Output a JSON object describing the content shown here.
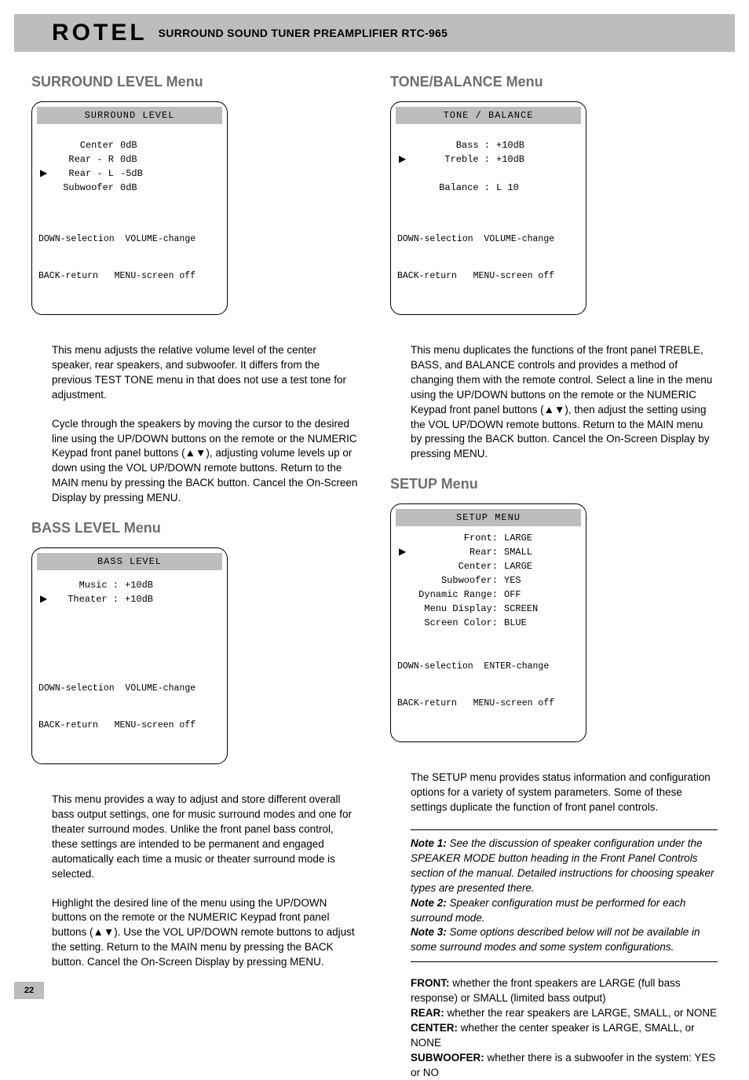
{
  "header": {
    "brand": "ROTEL",
    "product": "SURROUND SOUND TUNER PREAMPLIFIER  RTC-965"
  },
  "left": {
    "surround": {
      "heading": "SURROUND LEVEL Menu",
      "title": "SURROUND LEVEL",
      "rows": [
        {
          "cursor": " ",
          "label": "Center",
          "val": "0dB"
        },
        {
          "cursor": " ",
          "label": "Rear - R",
          "val": "0dB"
        },
        {
          "cursor": "▶",
          "label": "Rear - L",
          "val": "-5dB"
        },
        {
          "cursor": " ",
          "label": "Subwoofer",
          "val": "0dB"
        }
      ],
      "hints1": "DOWN-selection  VOLUME-change",
      "hints2": "BACK-return   MENU-screen off",
      "para1": "This menu adjusts the relative volume level of the center speaker, rear speakers, and subwoofer. It differs from the previous TEST TONE menu in that does not use a test tone for adjustment.",
      "para2": "Cycle through the speakers by moving the cursor to the desired line using the UP/DOWN buttons on the remote or the NUMERIC Keypad front panel buttons (▲▼), adjusting volume levels up or down using the VOL UP/DOWN remote buttons. Return to the MAIN menu by pressing the BACK button. Cancel the On-Screen Display by pressing MENU."
    },
    "bass": {
      "heading": "BASS LEVEL Menu",
      "title": "BASS LEVEL",
      "rows": [
        {
          "cursor": " ",
          "label": "Music :",
          "val": "+10dB"
        },
        {
          "cursor": "▶",
          "label": "Theater :",
          "val": "+10dB"
        }
      ],
      "hints1": "DOWN-selection  VOLUME-change",
      "hints2": "BACK-return   MENU-screen off",
      "para1": "This menu provides a way to adjust and store different overall bass output settings, one for music surround modes and one for theater surround modes. Unlike the front panel bass control, these settings are intended to be permanent and engaged automatically each time a music or theater surround mode is selected.",
      "para2": "Highlight the desired line of the menu using the UP/DOWN buttons on the remote or the NUMERIC Keypad front panel buttons (▲▼). Use the VOL UP/DOWN remote buttons to adjust the setting. Return to the MAIN menu by pressing the BACK button. Cancel the On-Screen Display by pressing MENU."
    }
  },
  "right": {
    "tone": {
      "heading": "TONE/BALANCE Menu",
      "title": "TONE / BALANCE",
      "rows": [
        {
          "cursor": " ",
          "label": "Bass :",
          "val": "+10dB"
        },
        {
          "cursor": "▶",
          "label": "Treble :",
          "val": "+10dB"
        },
        {
          "cursor": " ",
          "label": "",
          "val": ""
        },
        {
          "cursor": " ",
          "label": "Balance :",
          "val": "L 10"
        }
      ],
      "hints1": "DOWN-selection  VOLUME-change",
      "hints2": "BACK-return   MENU-screen off",
      "para1": "This menu duplicates the functions of the front panel TREBLE, BASS, and BALANCE controls and provides a method of changing them with the remote control. Select a line in the menu using the UP/DOWN buttons on the remote or the NUMERIC Keypad front panel buttons (▲▼), then adjust the setting using the VOL UP/DOWN remote buttons. Return to the MAIN menu by pressing the BACK button. Cancel the On-Screen Display by pressing MENU."
    },
    "setup": {
      "heading": "SETUP Menu",
      "title": "SETUP MENU",
      "rows": [
        {
          "cursor": " ",
          "label": "Front:",
          "val": "LARGE"
        },
        {
          "cursor": "▶",
          "label": "Rear:",
          "val": "SMALL"
        },
        {
          "cursor": " ",
          "label": "Center:",
          "val": "LARGE"
        },
        {
          "cursor": " ",
          "label": "Subwoofer:",
          "val": "YES"
        },
        {
          "cursor": " ",
          "label": "Dynamic Range:",
          "val": "OFF"
        },
        {
          "cursor": " ",
          "label": "Menu Display:",
          "val": "SCREEN"
        },
        {
          "cursor": " ",
          "label": "Screen Color:",
          "val": "BLUE"
        }
      ],
      "hints1": "DOWN-selection  ENTER-change",
      "hints2": "BACK-return   MENU-screen off",
      "para1": "The SETUP menu provides status information and configuration options for a variety of system parameters. Some of these settings duplicate the function of front panel controls.",
      "notes": {
        "n1l": "Note 1:",
        "n1t": " See the discussion of speaker configuration under the SPEAKER MODE button heading in the Front Panel Controls section of the manual. Detailed instructions for choosing speaker types are presented there.",
        "n2l": "Note 2:",
        "n2t": " Speaker configuration must be performed for each surround mode.",
        "n3l": "Note 3:",
        "n3t": " Some options described below will not be available in some surround modes and some system configurations."
      },
      "defs": {
        "d1l": "FRONT:",
        "d1t": " whether the front speakers are LARGE (full bass response) or SMALL (limited bass output)",
        "d2l": "REAR:",
        "d2t": " whether the rear speakers are LARGE, SMALL, or NONE",
        "d3l": "CENTER:",
        "d3t": " whether the center speaker is LARGE, SMALL, or NONE",
        "d4l": "SUBWOOFER:",
        "d4t": " whether there is a subwoofer in the system: YES or NO"
      }
    }
  },
  "page": "22"
}
